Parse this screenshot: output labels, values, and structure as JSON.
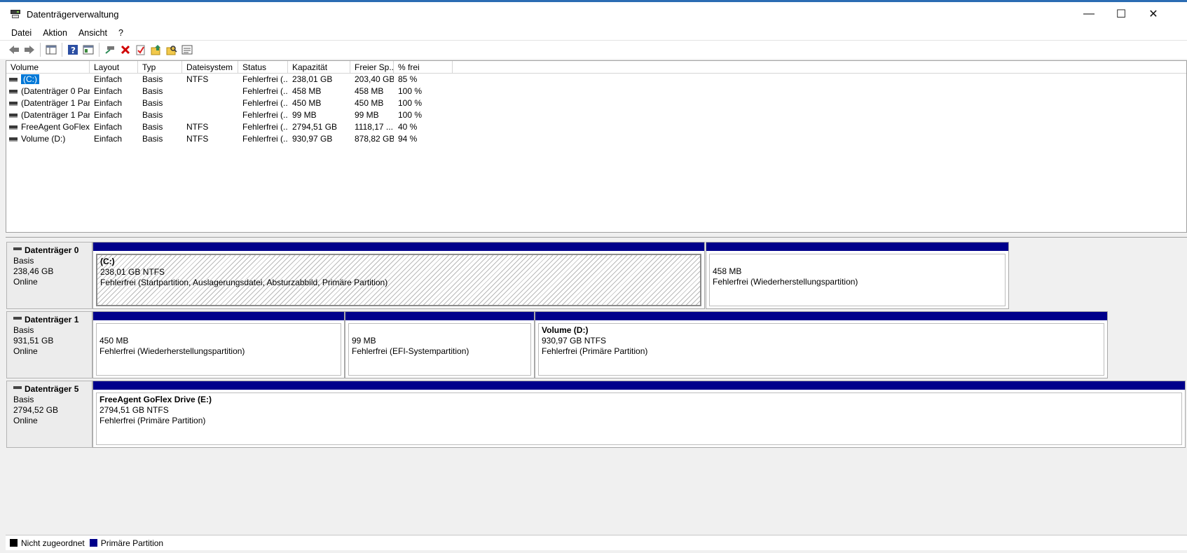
{
  "window": {
    "title": "Datenträgerverwaltung",
    "controls": {
      "minimize": "—",
      "maximize": "☐",
      "close": "✕"
    }
  },
  "menu": [
    "Datei",
    "Aktion",
    "Ansicht",
    "?"
  ],
  "toolbar_icons": [
    "back-icon",
    "forward-icon",
    "console-tree-icon",
    "help-icon",
    "properties-icon",
    "connect-icon",
    "delete-icon",
    "check-icon",
    "export-icon",
    "search-icon",
    "details-icon"
  ],
  "volume_table": {
    "columns": [
      "Volume",
      "Layout",
      "Typ",
      "Dateisystem",
      "Status",
      "Kapazität",
      "Freier Sp...",
      "% frei"
    ],
    "rows": [
      {
        "volume": "(C:)",
        "layout": "Einfach",
        "typ": "Basis",
        "fs": "NTFS",
        "status": "Fehlerfrei (...",
        "kapazitaet": "238,01 GB",
        "frei": "203,40 GB",
        "prozent": "85 %",
        "selected": true
      },
      {
        "volume": "(Datenträger 0 Par...",
        "layout": "Einfach",
        "typ": "Basis",
        "fs": "",
        "status": "Fehlerfrei (...",
        "kapazitaet": "458 MB",
        "frei": "458 MB",
        "prozent": "100 %"
      },
      {
        "volume": "(Datenträger 1 Par...",
        "layout": "Einfach",
        "typ": "Basis",
        "fs": "",
        "status": "Fehlerfrei (...",
        "kapazitaet": "450 MB",
        "frei": "450 MB",
        "prozent": "100 %"
      },
      {
        "volume": "(Datenträger 1 Par...",
        "layout": "Einfach",
        "typ": "Basis",
        "fs": "",
        "status": "Fehlerfrei (...",
        "kapazitaet": "99 MB",
        "frei": "99 MB",
        "prozent": "100 %"
      },
      {
        "volume": "FreeAgent GoFlex ...",
        "layout": "Einfach",
        "typ": "Basis",
        "fs": "NTFS",
        "status": "Fehlerfrei (...",
        "kapazitaet": "2794,51 GB",
        "frei": "1118,17 ...",
        "prozent": "40 %"
      },
      {
        "volume": "Volume (D:)",
        "layout": "Einfach",
        "typ": "Basis",
        "fs": "NTFS",
        "status": "Fehlerfrei (...",
        "kapazitaet": "930,97 GB",
        "frei": "878,82 GB",
        "prozent": "94 %"
      }
    ]
  },
  "disks": [
    {
      "name": "Datenträger 0",
      "type": "Basis",
      "size": "238,46 GB",
      "state": "Online",
      "partitions": [
        {
          "name": "(C:)",
          "size": "238,01 GB NTFS",
          "status": "Fehlerfrei (Startpartition, Auslagerungsdatei, Absturzabbild, Primäre Partition)",
          "selected": true
        },
        {
          "name": "",
          "size": "458 MB",
          "status": "Fehlerfrei (Wiederherstellungspartition)"
        }
      ]
    },
    {
      "name": "Datenträger 1",
      "type": "Basis",
      "size": "931,51 GB",
      "state": "Online",
      "partitions": [
        {
          "name": "",
          "size": "450 MB",
          "status": "Fehlerfrei (Wiederherstellungspartition)"
        },
        {
          "name": "",
          "size": "99 MB",
          "status": "Fehlerfrei (EFI-Systempartition)"
        },
        {
          "name": "Volume  (D:)",
          "size": "930,97 GB NTFS",
          "status": "Fehlerfrei (Primäre Partition)"
        }
      ]
    },
    {
      "name": "Datenträger 5",
      "type": "Basis",
      "size": "2794,52 GB",
      "state": "Online",
      "partitions": [
        {
          "name": "FreeAgent GoFlex Drive  (E:)",
          "size": "2794,51 GB NTFS",
          "status": "Fehlerfrei (Primäre Partition)"
        }
      ]
    }
  ],
  "legend": [
    {
      "label": "Nicht zugeordnet",
      "color": "#000000"
    },
    {
      "label": "Primäre Partition",
      "color": "#00008b"
    }
  ]
}
